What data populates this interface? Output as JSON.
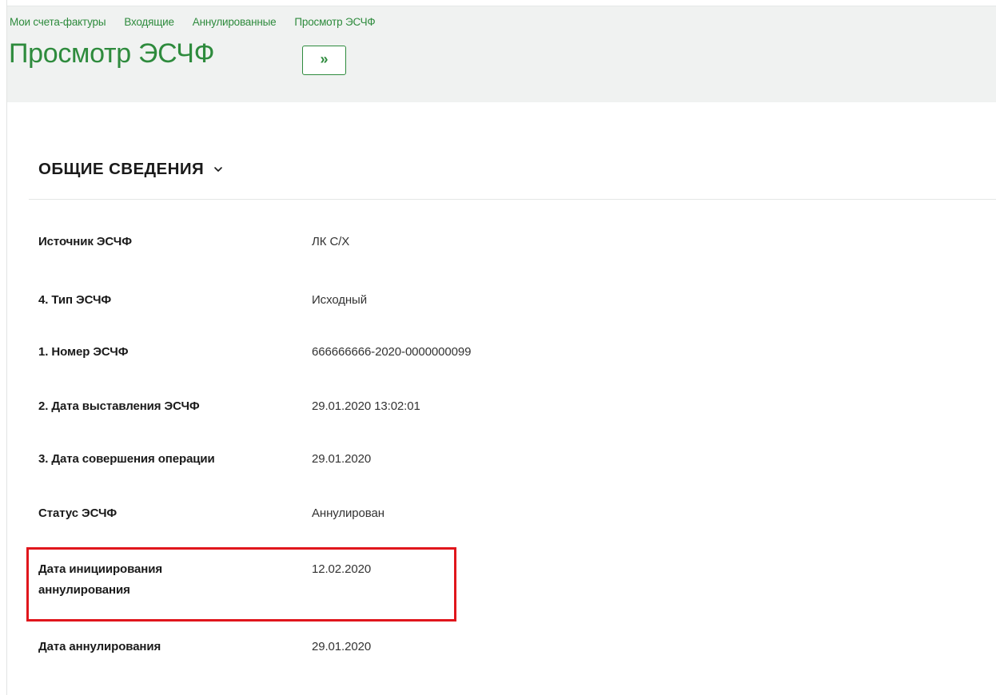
{
  "header": {
    "breadcrumb": [
      "Мои счета-фактуры",
      "Входящие",
      "Аннулированные",
      "Просмотр ЭСЧФ"
    ],
    "title": "Просмотр ЭСЧФ",
    "expand_button_label": "»"
  },
  "section": {
    "title": "ОБЩИЕ СВЕДЕНИЯ",
    "toggle_icon": "chevron-down-icon"
  },
  "fields": [
    {
      "label": "Источник ЭСЧФ",
      "value": "ЛК С/Х"
    },
    {
      "label": "4. Тип ЭСЧФ",
      "value": "Исходный"
    },
    {
      "label": "1. Номер ЭСЧФ",
      "value": "666666666-2020-0000000099"
    },
    {
      "label": "2. Дата выставления ЭСЧФ",
      "value": "29.01.2020 13:02:01"
    },
    {
      "label": "3. Дата совершения операции",
      "value": "29.01.2020"
    },
    {
      "label": "Статус ЭСЧФ",
      "value": "Аннулирован"
    },
    {
      "label_lines": [
        "Дата инициирования",
        "аннулирования"
      ],
      "value": "12.02.2020"
    },
    {
      "label": "Дата аннулирования",
      "value": "29.01.2020"
    }
  ],
  "colors": {
    "accent_green": "#2e8b3d",
    "header_bg": "#f0f2f1",
    "highlight_red": "#e0161c"
  }
}
